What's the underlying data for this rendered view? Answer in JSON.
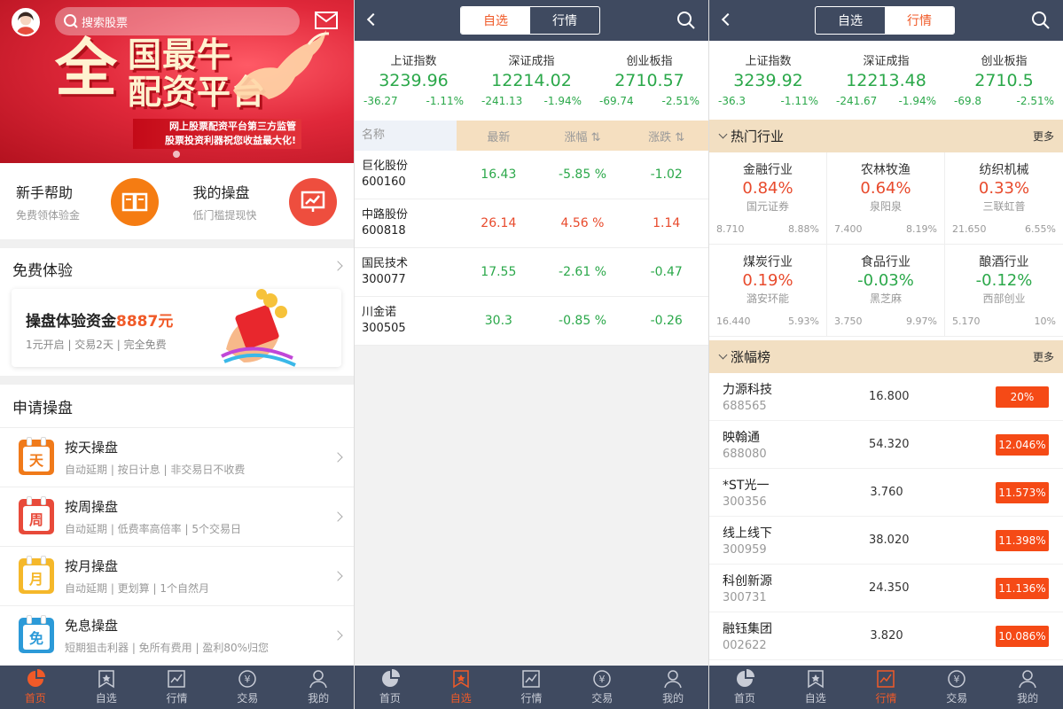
{
  "home": {
    "search_placeholder": "搜索股票",
    "banner": {
      "big": "全",
      "line1": "国最牛",
      "line2": "配资平台",
      "sub1": "网上股票配资平台第三方监管",
      "sub2": "股票投资利器祝您收益最大化!"
    },
    "quick": [
      {
        "title": "新手帮助",
        "sub": "免费领体验金"
      },
      {
        "title": "我的操盘",
        "sub": "低门槛提现快"
      }
    ],
    "free_title": "免费体验",
    "exp": {
      "title": "操盘体验资金",
      "amount": "8887元",
      "sub": "1元开启 | 交易2天 | 完全免费"
    },
    "apply_title": "申请操盘",
    "plans": [
      {
        "icon_char": "天",
        "title": "按天操盘",
        "sub": "自动延期 | 按日计息 | 非交易日不收费",
        "color": "#f07a1a"
      },
      {
        "icon_char": "周",
        "title": "按周操盘",
        "sub": "自动延期 | 低费率高倍率 | 5个交易日",
        "color": "#e84a3a"
      },
      {
        "icon_char": "月",
        "title": "按月操盘",
        "sub": "自动延期 | 更划算 | 1个自然月",
        "color": "#f5b82a"
      },
      {
        "icon_char": "免",
        "title": "免息操盘",
        "sub": "短期狙击利器 | 免所有费用 | 盈利80%归您",
        "color": "#2c9ad8"
      }
    ]
  },
  "tabs": [
    "首页",
    "自选",
    "行情",
    "交易",
    "我的"
  ],
  "seg": {
    "left": "自选",
    "right": "行情"
  },
  "watch": {
    "indices": [
      {
        "name": "上证指数",
        "value": "3239.96",
        "chg": "-36.27",
        "pct": "-1.11%"
      },
      {
        "name": "深证成指",
        "value": "12214.02",
        "chg": "-241.13",
        "pct": "-1.94%"
      },
      {
        "name": "创业板指",
        "value": "2710.57",
        "chg": "-69.74",
        "pct": "-2.51%"
      }
    ],
    "headers": [
      "名称",
      "最新",
      "涨幅 ⇅",
      "涨跌 ⇅"
    ],
    "rows": [
      {
        "name": "巨化股份",
        "code": "600160",
        "price": "16.43",
        "pct": "-5.85 %",
        "chg": "-1.02",
        "up": false
      },
      {
        "name": "中路股份",
        "code": "600818",
        "price": "26.14",
        "pct": "4.56 %",
        "chg": "1.14",
        "up": true
      },
      {
        "name": "国民技术",
        "code": "300077",
        "price": "17.55",
        "pct": "-2.61 %",
        "chg": "-0.47",
        "up": false
      },
      {
        "name": "川金诺",
        "code": "300505",
        "price": "30.3",
        "pct": "-0.85 %",
        "chg": "-0.26",
        "up": false
      }
    ]
  },
  "market": {
    "indices": [
      {
        "name": "上证指数",
        "value": "3239.92",
        "chg": "-36.3",
        "pct": "-1.11%"
      },
      {
        "name": "深证成指",
        "value": "12213.48",
        "chg": "-241.67",
        "pct": "-1.94%"
      },
      {
        "name": "创业板指",
        "value": "2710.5",
        "chg": "-69.8",
        "pct": "-2.51%"
      }
    ],
    "hot_title": "热门行业",
    "more": "更多",
    "industries": [
      {
        "name": "金融行业",
        "pct": "0.84%",
        "leader": "国元证券",
        "price": "8.710",
        "lpct": "8.88%",
        "up": true
      },
      {
        "name": "农林牧渔",
        "pct": "0.64%",
        "leader": "泉阳泉",
        "price": "7.400",
        "lpct": "8.19%",
        "up": true
      },
      {
        "name": "纺织机械",
        "pct": "0.33%",
        "leader": "三联虹普",
        "price": "21.650",
        "lpct": "6.55%",
        "up": true
      },
      {
        "name": "煤炭行业",
        "pct": "0.19%",
        "leader": "潞安环能",
        "price": "16.440",
        "lpct": "5.93%",
        "up": true
      },
      {
        "name": "食品行业",
        "pct": "-0.03%",
        "leader": "黑芝麻",
        "price": "3.750",
        "lpct": "9.97%",
        "up": false
      },
      {
        "name": "酿酒行业",
        "pct": "-0.12%",
        "leader": "西部创业",
        "price": "5.170",
        "lpct": "10%",
        "up": false
      }
    ],
    "rank_title": "涨幅榜",
    "ranks": [
      {
        "name": "力源科技",
        "code": "688565",
        "price": "16.800",
        "pct": "20%"
      },
      {
        "name": "映翰通",
        "code": "688080",
        "price": "54.320",
        "pct": "12.046%"
      },
      {
        "name": "*ST光一",
        "code": "300356",
        "price": "3.760",
        "pct": "11.573%"
      },
      {
        "name": "线上线下",
        "code": "300959",
        "price": "38.020",
        "pct": "11.398%"
      },
      {
        "name": "科创新源",
        "code": "300731",
        "price": "24.350",
        "pct": "11.136%"
      },
      {
        "name": "融钰集团",
        "code": "002622",
        "price": "3.820",
        "pct": "10.086%"
      }
    ]
  }
}
